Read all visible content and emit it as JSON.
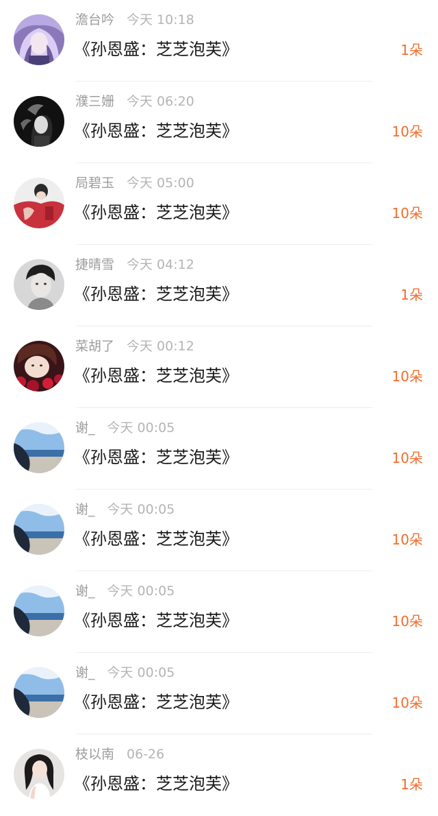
{
  "gift_list": [
    {
      "name": "澹台吟",
      "time": "今天 10:18",
      "title": "《孙恩盛：芝芝泡芙》",
      "count": "1朵",
      "avatar": "avatar-purple-hair-girl"
    },
    {
      "name": "濮三姗",
      "time": "今天 06:20",
      "title": "《孙恩盛：芝芝泡芙》",
      "count": "10朵",
      "avatar": "avatar-dark-smoke"
    },
    {
      "name": "局碧玉",
      "time": "今天 05:00",
      "title": "《孙恩盛：芝芝泡芙》",
      "count": "10朵",
      "avatar": "avatar-red-shirt-boy"
    },
    {
      "name": "捷晴雪",
      "time": "今天 04:12",
      "title": "《孙恩盛：芝芝泡芙》",
      "count": "1朵",
      "avatar": "avatar-black-white-boy"
    },
    {
      "name": "菜胡了",
      "time": "今天 00:12",
      "title": "《孙恩盛：芝芝泡芙》",
      "count": "10朵",
      "avatar": "avatar-boy-red-flowers"
    },
    {
      "name": "谢_",
      "time": "今天 00:05",
      "title": "《孙恩盛：芝芝泡芙》",
      "count": "10朵",
      "avatar": "avatar-seaside"
    },
    {
      "name": "谢_",
      "time": "今天 00:05",
      "title": "《孙恩盛：芝芝泡芙》",
      "count": "10朵",
      "avatar": "avatar-seaside"
    },
    {
      "name": "谢_",
      "time": "今天 00:05",
      "title": "《孙恩盛：芝芝泡芙》",
      "count": "10朵",
      "avatar": "avatar-seaside"
    },
    {
      "name": "谢_",
      "time": "今天 00:05",
      "title": "《孙恩盛：芝芝泡芙》",
      "count": "10朵",
      "avatar": "avatar-seaside"
    },
    {
      "name": "枝以南",
      "time": "06-26",
      "title": "《孙恩盛：芝芝泡芙》",
      "count": "1朵",
      "avatar": "avatar-girl-white-top"
    }
  ],
  "colors": {
    "count_orange": "#f36c2b",
    "name_gray": "#9c9c9c",
    "title_black": "#1a1a1a"
  }
}
